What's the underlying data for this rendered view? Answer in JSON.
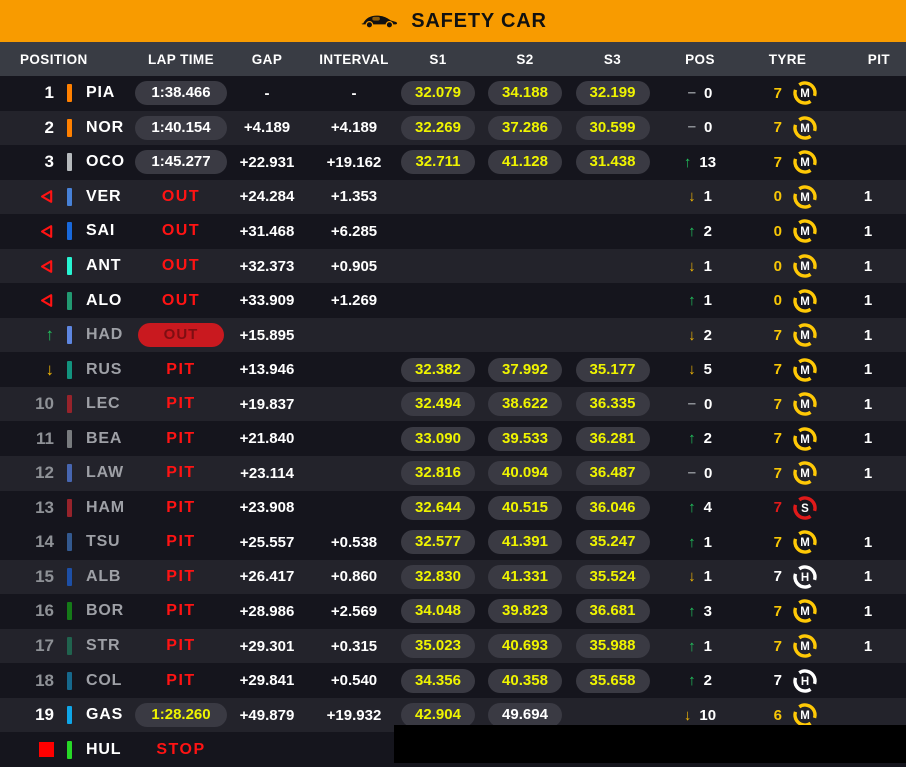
{
  "banner": {
    "label": "SAFETY CAR"
  },
  "columns": [
    "POSITION",
    "LAP TIME",
    "GAP",
    "INTERVAL",
    "S1",
    "S2",
    "S3",
    "POS",
    "TYRE",
    "PIT"
  ],
  "icons": {
    "up-arrow": "↑",
    "down-arrow": "↓",
    "dash": "–"
  },
  "colors": {
    "banner_orange": "#F89B00",
    "header_gray": "#393C44",
    "row_dark": "#15151D",
    "row_light": "#23232B",
    "sector_yellow": "#EFF400",
    "alert_red": "#FF1313",
    "up_green": "#22C55E",
    "down_amber": "#F2B705",
    "tyre_medium": "#FFC906",
    "tyre_soft": "#E01A1A",
    "tyre_hard": "#FFFFFF"
  },
  "rows": [
    {
      "bg": "dark",
      "marker": "number",
      "pos": "1",
      "pos_gray": false,
      "team": "#FF8000",
      "driver": "PIA",
      "dim": false,
      "lap": {
        "mode": "pill",
        "text": "1:38.466",
        "best": false
      },
      "gap": "-",
      "interval": "-",
      "s1": "32.079",
      "s2": "34.188",
      "s3": "32.199",
      "s2_white": false,
      "chg": {
        "dir": "none",
        "val": "0"
      },
      "tyre": {
        "laps": "7",
        "laps_color": "#F7C606",
        "compound": "M",
        "color": "#FFC906"
      },
      "pit": ""
    },
    {
      "bg": "light",
      "marker": "number",
      "pos": "2",
      "pos_gray": false,
      "team": "#FF8000",
      "driver": "NOR",
      "dim": false,
      "lap": {
        "mode": "pill",
        "text": "1:40.154",
        "best": false
      },
      "gap": "+4.189",
      "interval": "+4.189",
      "s1": "32.269",
      "s2": "37.286",
      "s3": "30.599",
      "s2_white": false,
      "chg": {
        "dir": "none",
        "val": "0"
      },
      "tyre": {
        "laps": "7",
        "laps_color": "#F7C606",
        "compound": "M",
        "color": "#FFC906"
      },
      "pit": ""
    },
    {
      "bg": "dark",
      "marker": "number",
      "pos": "3",
      "pos_gray": false,
      "team": "#B6BABD",
      "driver": "OCO",
      "dim": false,
      "lap": {
        "mode": "pill",
        "text": "1:45.277",
        "best": false
      },
      "gap": "+22.931",
      "interval": "+19.162",
      "s1": "32.711",
      "s2": "41.128",
      "s3": "31.438",
      "s2_white": false,
      "chg": {
        "dir": "up",
        "val": "13"
      },
      "tyre": {
        "laps": "7",
        "laps_color": "#F7C606",
        "compound": "M",
        "color": "#FFC906"
      },
      "pit": ""
    },
    {
      "bg": "light",
      "marker": "triangle",
      "pos": "",
      "pos_gray": false,
      "team": "#4781D7",
      "driver": "VER",
      "dim": false,
      "lap": {
        "mode": "alert",
        "text": "OUT"
      },
      "gap": "+24.284",
      "interval": "+1.353",
      "s1": "",
      "s2": "",
      "s3": "",
      "s2_white": false,
      "chg": {
        "dir": "down",
        "val": "1"
      },
      "tyre": {
        "laps": "0",
        "laps_color": "#F7C606",
        "compound": "M",
        "color": "#FFC906"
      },
      "pit": "1"
    },
    {
      "bg": "dark",
      "marker": "triangle",
      "pos": "",
      "pos_gray": false,
      "team": "#1868DB",
      "driver": "SAI",
      "dim": false,
      "lap": {
        "mode": "alert",
        "text": "OUT"
      },
      "gap": "+31.468",
      "interval": "+6.285",
      "s1": "",
      "s2": "",
      "s3": "",
      "s2_white": false,
      "chg": {
        "dir": "up",
        "val": "2"
      },
      "tyre": {
        "laps": "0",
        "laps_color": "#F7C606",
        "compound": "M",
        "color": "#FFC906"
      },
      "pit": "1"
    },
    {
      "bg": "light",
      "marker": "triangle",
      "pos": "",
      "pos_gray": false,
      "team": "#27F4D2",
      "driver": "ANT",
      "dim": false,
      "lap": {
        "mode": "alert",
        "text": "OUT"
      },
      "gap": "+32.373",
      "interval": "+0.905",
      "s1": "",
      "s2": "",
      "s3": "",
      "s2_white": false,
      "chg": {
        "dir": "down",
        "val": "1"
      },
      "tyre": {
        "laps": "0",
        "laps_color": "#F7C606",
        "compound": "M",
        "color": "#FFC906"
      },
      "pit": "1"
    },
    {
      "bg": "dark",
      "marker": "triangle",
      "pos": "",
      "pos_gray": false,
      "team": "#229971",
      "driver": "ALO",
      "dim": false,
      "lap": {
        "mode": "alert",
        "text": "OUT"
      },
      "gap": "+33.909",
      "interval": "+1.269",
      "s1": "",
      "s2": "",
      "s3": "",
      "s2_white": false,
      "chg": {
        "dir": "up",
        "val": "1"
      },
      "tyre": {
        "laps": "0",
        "laps_color": "#F7C606",
        "compound": "M",
        "color": "#FFC906"
      },
      "pit": "1"
    },
    {
      "bg": "light",
      "marker": "up",
      "pos": "",
      "pos_gray": false,
      "team": "#5E86E0",
      "driver": "HAD",
      "dim": true,
      "lap": {
        "mode": "alert-pill",
        "text": "OUT"
      },
      "gap": "+15.895",
      "interval": "",
      "s1": "",
      "s2": "",
      "s3": "",
      "s2_white": false,
      "chg": {
        "dir": "down",
        "val": "2"
      },
      "tyre": {
        "laps": "7",
        "laps_color": "#F7C606",
        "compound": "M",
        "color": "#FFC906"
      },
      "pit": "1"
    },
    {
      "bg": "dark",
      "marker": "down",
      "pos": "",
      "pos_gray": false,
      "team": "#12937E",
      "driver": "RUS",
      "dim": true,
      "lap": {
        "mode": "alert",
        "text": "PIT"
      },
      "gap": "+13.946",
      "interval": "",
      "s1": "32.382",
      "s2": "37.992",
      "s3": "35.177",
      "s2_white": false,
      "chg": {
        "dir": "down",
        "val": "5"
      },
      "tyre": {
        "laps": "7",
        "laps_color": "#F7C606",
        "compound": "M",
        "color": "#FFC906"
      },
      "pit": "1"
    },
    {
      "bg": "light",
      "marker": "number",
      "pos": "10",
      "pos_gray": true,
      "team": "#97232B",
      "driver": "LEC",
      "dim": true,
      "lap": {
        "mode": "alert",
        "text": "PIT"
      },
      "gap": "+19.837",
      "interval": "",
      "s1": "32.494",
      "s2": "38.622",
      "s3": "36.335",
      "s2_white": false,
      "chg": {
        "dir": "none",
        "val": "0"
      },
      "tyre": {
        "laps": "7",
        "laps_color": "#F7C606",
        "compound": "M",
        "color": "#FFC906"
      },
      "pit": "1"
    },
    {
      "bg": "dark",
      "marker": "number",
      "pos": "11",
      "pos_gray": true,
      "team": "#787B7E",
      "driver": "BEA",
      "dim": true,
      "lap": {
        "mode": "alert",
        "text": "PIT"
      },
      "gap": "+21.840",
      "interval": "",
      "s1": "33.090",
      "s2": "39.533",
      "s3": "36.281",
      "s2_white": false,
      "chg": {
        "dir": "up",
        "val": "2"
      },
      "tyre": {
        "laps": "7",
        "laps_color": "#F7C606",
        "compound": "M",
        "color": "#FFC906"
      },
      "pit": "1"
    },
    {
      "bg": "light",
      "marker": "number",
      "pos": "12",
      "pos_gray": true,
      "team": "#4766B0",
      "driver": "LAW",
      "dim": true,
      "lap": {
        "mode": "alert",
        "text": "PIT"
      },
      "gap": "+23.114",
      "interval": "",
      "s1": "32.816",
      "s2": "40.094",
      "s3": "36.487",
      "s2_white": false,
      "chg": {
        "dir": "none",
        "val": "0"
      },
      "tyre": {
        "laps": "7",
        "laps_color": "#F7C606",
        "compound": "M",
        "color": "#FFC906"
      },
      "pit": "1"
    },
    {
      "bg": "dark",
      "marker": "number",
      "pos": "13",
      "pos_gray": true,
      "team": "#97232B",
      "driver": "HAM",
      "dim": true,
      "lap": {
        "mode": "alert",
        "text": "PIT"
      },
      "gap": "+23.908",
      "interval": "",
      "s1": "32.644",
      "s2": "40.515",
      "s3": "36.046",
      "s2_white": false,
      "chg": {
        "dir": "up",
        "val": "4"
      },
      "tyre": {
        "laps": "7",
        "laps_color": "#E01A1A",
        "compound": "S",
        "color": "#E01A1A"
      },
      "pit": ""
    },
    {
      "bg": "dark",
      "marker": "number",
      "pos": "14",
      "pos_gray": true,
      "team": "#33598F",
      "driver": "TSU",
      "dim": true,
      "lap": {
        "mode": "alert",
        "text": "PIT"
      },
      "gap": "+25.557",
      "interval": "+0.538",
      "s1": "32.577",
      "s2": "41.391",
      "s3": "35.247",
      "s2_white": false,
      "chg": {
        "dir": "up",
        "val": "1"
      },
      "tyre": {
        "laps": "7",
        "laps_color": "#F7C606",
        "compound": "M",
        "color": "#FFC906"
      },
      "pit": "1"
    },
    {
      "bg": "light",
      "marker": "number",
      "pos": "15",
      "pos_gray": true,
      "team": "#1D4FA6",
      "driver": "ALB",
      "dim": true,
      "lap": {
        "mode": "alert",
        "text": "PIT"
      },
      "gap": "+26.417",
      "interval": "+0.860",
      "s1": "32.830",
      "s2": "41.331",
      "s3": "35.524",
      "s2_white": false,
      "chg": {
        "dir": "down",
        "val": "1"
      },
      "tyre": {
        "laps": "7",
        "laps_color": "#FFFFFF",
        "compound": "H",
        "color": "#FFFFFF"
      },
      "pit": "1"
    },
    {
      "bg": "dark",
      "marker": "number",
      "pos": "16",
      "pos_gray": true,
      "team": "#157A18",
      "driver": "BOR",
      "dim": true,
      "lap": {
        "mode": "alert",
        "text": "PIT"
      },
      "gap": "+28.986",
      "interval": "+2.569",
      "s1": "34.048",
      "s2": "39.823",
      "s3": "36.681",
      "s2_white": false,
      "chg": {
        "dir": "up",
        "val": "3"
      },
      "tyre": {
        "laps": "7",
        "laps_color": "#F7C606",
        "compound": "M",
        "color": "#FFC906"
      },
      "pit": "1"
    },
    {
      "bg": "light",
      "marker": "number",
      "pos": "17",
      "pos_gray": true,
      "team": "#20634E",
      "driver": "STR",
      "dim": true,
      "lap": {
        "mode": "alert",
        "text": "PIT"
      },
      "gap": "+29.301",
      "interval": "+0.315",
      "s1": "35.023",
      "s2": "40.693",
      "s3": "35.988",
      "s2_white": false,
      "chg": {
        "dir": "up",
        "val": "1"
      },
      "tyre": {
        "laps": "7",
        "laps_color": "#F7C606",
        "compound": "M",
        "color": "#FFC906"
      },
      "pit": "1"
    },
    {
      "bg": "dark",
      "marker": "number",
      "pos": "18",
      "pos_gray": true,
      "team": "#16688C",
      "driver": "COL",
      "dim": true,
      "lap": {
        "mode": "alert",
        "text": "PIT"
      },
      "gap": "+29.841",
      "interval": "+0.540",
      "s1": "34.356",
      "s2": "40.358",
      "s3": "35.658",
      "s2_white": false,
      "chg": {
        "dir": "up",
        "val": "2"
      },
      "tyre": {
        "laps": "7",
        "laps_color": "#FFFFFF",
        "compound": "H",
        "color": "#FFFFFF"
      },
      "pit": ""
    },
    {
      "bg": "light",
      "marker": "number",
      "pos": "19",
      "pos_gray": false,
      "team": "#0FA6E8",
      "driver": "GAS",
      "dim": false,
      "lap": {
        "mode": "pill",
        "text": "1:28.260",
        "best": true
      },
      "gap": "+49.879",
      "interval": "+19.932",
      "s1": "42.904",
      "s2": "49.694",
      "s3": "",
      "s2_white": true,
      "chg": {
        "dir": "down",
        "val": "10"
      },
      "tyre": {
        "laps": "6",
        "laps_color": "#F7C606",
        "compound": "M",
        "color": "#FFC906"
      },
      "pit": ""
    },
    {
      "bg": "dark",
      "marker": "square",
      "pos": "",
      "pos_gray": false,
      "team": "#27D827",
      "driver": "HUL",
      "dim": false,
      "lap": {
        "mode": "alert",
        "text": "STOP"
      },
      "gap": "",
      "interval": "",
      "s1": "",
      "s2": "",
      "s3": "",
      "s2_white": false,
      "chg": {
        "dir": "",
        "val": ""
      },
      "tyre": {
        "laps": "",
        "laps_color": "",
        "compound": "",
        "color": ""
      },
      "pit": ""
    }
  ]
}
